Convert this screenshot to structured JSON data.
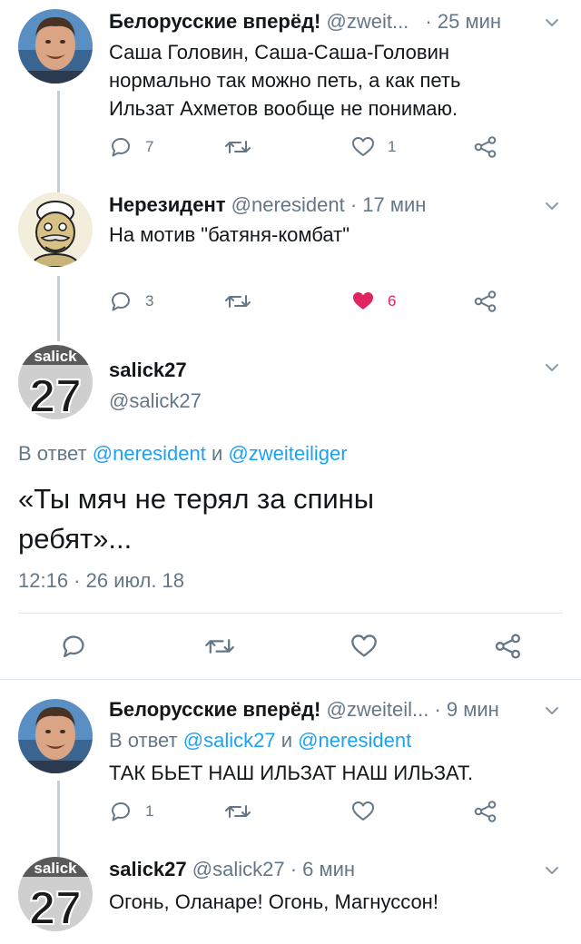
{
  "tweets": [
    {
      "author_name": "Белорусские вперёд!",
      "handle": "@zweit...",
      "time": "· 25 мин",
      "text_lines": [
        "Саша Головин, Саша-Саша-Головин",
        "нормально так можно петь, а как петь",
        "Ильзат Ахметов вообще не понимаю."
      ],
      "replies": "7",
      "likes": "1"
    },
    {
      "author_name": "Нерезидент",
      "handle": "@neresident",
      "time": "· 17 мин",
      "text_lines": [
        "На мотив \"батяня-комбат\""
      ],
      "replies": "3",
      "likes": "6",
      "liked": true
    }
  ],
  "focused_tweet": {
    "author_name": "salick27",
    "handle": "@salick27",
    "reply_prefix": "В ответ",
    "reply_user_1": "@neresident",
    "reply_and": "и",
    "reply_user_2": "@zweiteiliger",
    "text_lines": [
      "«Ты мяч не терял за спины",
      "ребят»..."
    ],
    "timestamp": "12:16 · 26 июл. 18"
  },
  "replies": [
    {
      "author_name": "Белорусские вперёд!",
      "handle": "@zweiteil...",
      "time": "· 9 мин",
      "reply_prefix": "В ответ",
      "reply_user_1": "@salick27",
      "reply_and": "и",
      "reply_user_2": "@neresident",
      "text": "ТАК БЬЕТ НАШ ИЛЬЗАТ НАШ ИЛЬЗАТ.",
      "replies": "1"
    },
    {
      "author_name": "salick27",
      "handle": "@salick27",
      "time": "· 6 мин",
      "text": "Огонь, Оланаре! Огонь, Магнуссон!"
    }
  ],
  "avatar_text": {
    "label_top": "salick",
    "label_number": "27"
  },
  "colors": {
    "text": "#14171a",
    "muted": "#657786",
    "link": "#1da1f2",
    "like": "#e0245e",
    "thread_line": "#c4cfd6",
    "divider": "#e1e8ed"
  },
  "icons": [
    "reply-icon",
    "retweet-icon",
    "like-icon",
    "share-icon",
    "chevron-down-icon"
  ]
}
